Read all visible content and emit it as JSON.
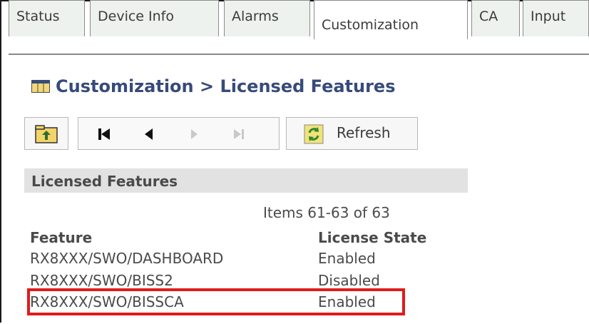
{
  "tabs": [
    {
      "label": "Status"
    },
    {
      "label": "Device Info"
    },
    {
      "label": "Alarms"
    },
    {
      "label": "Customization",
      "active": true
    },
    {
      "label": "CA"
    },
    {
      "label": "Input"
    }
  ],
  "heading": "Customization > Licensed Features",
  "toolbar": {
    "up_icon": "folder-up-icon",
    "nav_icons": [
      "first-page-icon",
      "previous-page-icon",
      "next-page-icon",
      "last-page-icon"
    ],
    "refresh_label": "Refresh",
    "refresh_icon": "refresh-icon"
  },
  "section_title": "Licensed Features",
  "pagination": "Items 61-63 of 63",
  "table": {
    "headers": [
      "Feature",
      "License State"
    ],
    "rows": [
      {
        "feature": "RX8XXX/SWO/DASHBOARD",
        "state": "Enabled"
      },
      {
        "feature": "RX8XXX/SWO/BISS2",
        "state": "Disabled"
      },
      {
        "feature": "RX8XXX/SWO/BISSCA",
        "state": "Enabled",
        "highlighted": true
      }
    ]
  },
  "colors": {
    "heading": "#374b7a",
    "highlight": "#e01b1b",
    "section_bg": "#e2e2e2"
  }
}
